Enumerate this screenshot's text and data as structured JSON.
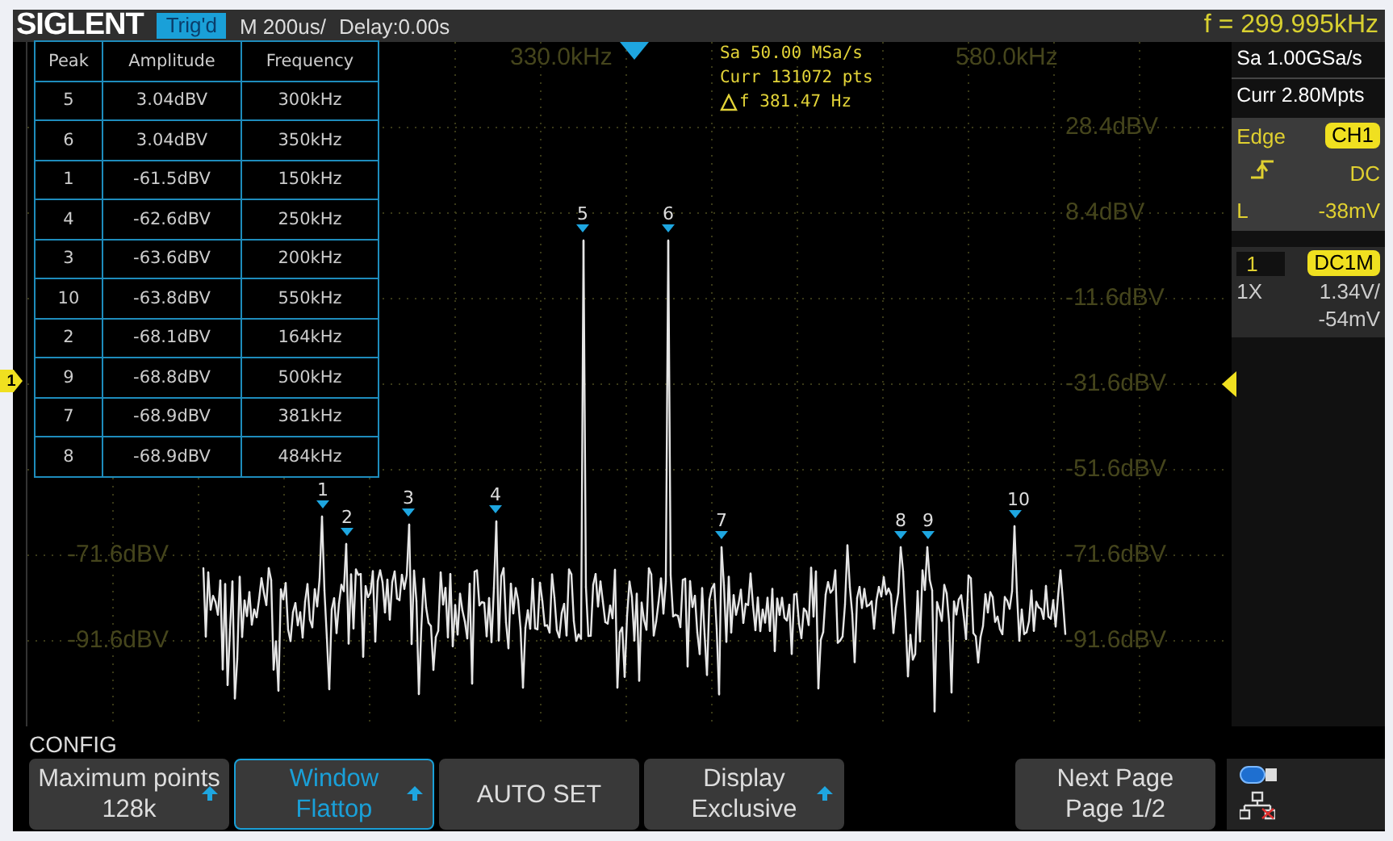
{
  "top_bar": {
    "logo": "SIGLENT",
    "trigger_status": "Trig'd",
    "timebase": "M 200us/",
    "delay": "Delay:0.00s",
    "frequency": "f = 299.995kHz"
  },
  "acquisition": {
    "sample_rate": "Sa 50.00 MSa/s",
    "points": "Curr 131072 pts",
    "resolution": "f 381.47 Hz"
  },
  "axis_labels": {
    "frequency": [
      "330.0kHz",
      "580.0kHz"
    ],
    "amplitude_left": [
      "-71.6dBV",
      "-91.6dBV"
    ],
    "amplitude_right": [
      "28.4dBV",
      "8.4dBV",
      "-11.6dBV",
      "-31.6dBV",
      "-51.6dBV",
      "-71.6dBV",
      "-91.6dBV"
    ]
  },
  "peak_table": {
    "columns": [
      "Peak",
      "Amplitude",
      "Frequency"
    ],
    "rows": [
      {
        "peak": "5",
        "amplitude": "3.04dBV",
        "frequency": "300kHz"
      },
      {
        "peak": "6",
        "amplitude": "3.04dBV",
        "frequency": "350kHz"
      },
      {
        "peak": "1",
        "amplitude": "-61.5dBV",
        "frequency": "150kHz"
      },
      {
        "peak": "4",
        "amplitude": "-62.6dBV",
        "frequency": "250kHz"
      },
      {
        "peak": "3",
        "amplitude": "-63.6dBV",
        "frequency": "200kHz"
      },
      {
        "peak": "10",
        "amplitude": "-63.8dBV",
        "frequency": "550kHz"
      },
      {
        "peak": "2",
        "amplitude": "-68.1dBV",
        "frequency": "164kHz"
      },
      {
        "peak": "9",
        "amplitude": "-68.8dBV",
        "frequency": "500kHz"
      },
      {
        "peak": "7",
        "amplitude": "-68.9dBV",
        "frequency": "381kHz"
      },
      {
        "peak": "8",
        "amplitude": "-68.9dBV",
        "frequency": "484kHz"
      }
    ]
  },
  "peak_markers": [
    "1",
    "2",
    "3",
    "4",
    "5",
    "6",
    "7",
    "8",
    "9",
    "10"
  ],
  "channel_marker": "1",
  "side_panel": {
    "sample_rate": "Sa 1.00GSa/s",
    "memory": "Curr 2.80Mpts",
    "trigger": {
      "type": "Edge",
      "source": "CH1",
      "coupling": "DC",
      "level_label": "L",
      "level_value": "-38mV"
    },
    "channel": {
      "number": "1",
      "coupling": "DC1M",
      "probe": "1X",
      "scale": "1.34V/",
      "offset": "-54mV"
    }
  },
  "menu": {
    "title": "CONFIG",
    "buttons": [
      {
        "label": "Maximum points",
        "value": "128k",
        "selected": false,
        "arrow": true
      },
      {
        "label": "Window",
        "value": "Flattop",
        "selected": true,
        "arrow": true
      },
      {
        "label": "AUTO SET",
        "selected": false,
        "arrow": false
      },
      {
        "label": "Display",
        "value": "Exclusive",
        "selected": false,
        "arrow": true
      },
      {
        "label": "Next Page",
        "value": "Page 1/2",
        "selected": false,
        "arrow": false
      }
    ]
  }
}
